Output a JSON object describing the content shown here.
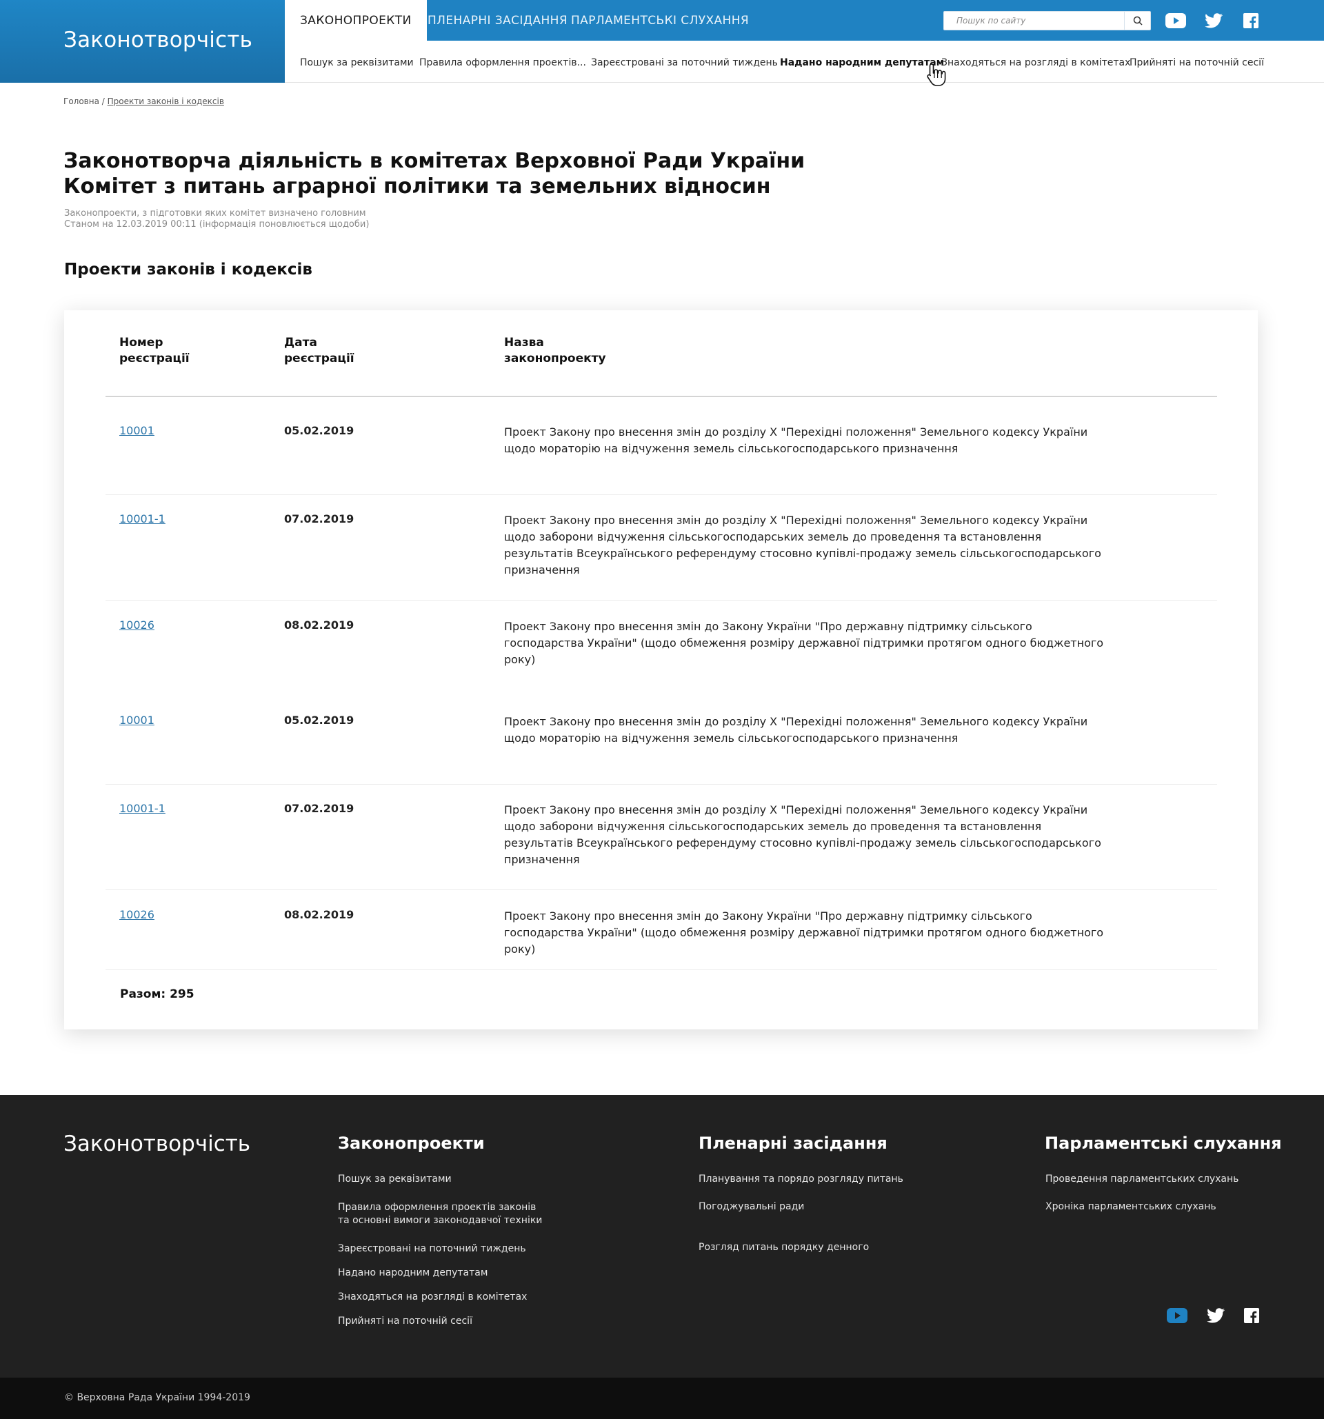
{
  "header": {
    "brand": "Законотворчість",
    "tabs": [
      {
        "label": "ЗАКОНОПРОЕКТИ",
        "active": true
      },
      {
        "label": "ПЛЕНАРНІ ЗАСІДАННЯ",
        "active": false
      },
      {
        "label": "ПАРЛАМЕНТСЬКІ СЛУХАННЯ",
        "active": false
      }
    ],
    "search": {
      "placeholder": "Пошук по сайту",
      "value": ""
    },
    "social": [
      "youtube-icon",
      "twitter-icon",
      "facebook-icon"
    ]
  },
  "subnav": {
    "items": [
      {
        "label": "Пошук за реквізитами"
      },
      {
        "label": "Правила оформлення проектів..."
      },
      {
        "label": "Зареєстровані за поточний тиждень"
      },
      {
        "label": "Надано народним депутатам"
      },
      {
        "label": "Знаходяться на розгляді в комітетах"
      },
      {
        "label": "Прийняті на поточній сесії"
      }
    ]
  },
  "breadcrumb": {
    "home": "Головна",
    "separator": " / ",
    "current": "Проекти законів і кодексів"
  },
  "page": {
    "title_line1": "Законотворча діяльність в комітетах Верховної Ради України",
    "title_line2": "Комітет з питань аграрної політики та земельних відносин",
    "meta_line1": "Законопроекти, з підготовки яких комітет визначено головним",
    "meta_line2": "Станом на 12.03.2019 00:11 (інформація поновлюється щодоби)",
    "section_title": "Проекти законів і кодексів"
  },
  "table": {
    "headers": {
      "number_line1": "Номер",
      "number_line2": "реєстрації",
      "date_line1": "Дата",
      "date_line2": "реєстрації",
      "name_line1": "Назва",
      "name_line2": "законопроекту"
    },
    "rows": [
      {
        "number": "10001",
        "date": "05.02.2019",
        "name": "Проект Закону про внесення змін до розділу X \"Перехідні положення\" Земельного кодексу України щодо мораторію на відчуження земель сільськогосподарського призначення"
      },
      {
        "number": "10001-1",
        "date": "07.02.2019",
        "name": "Проект Закону про внесення змін до розділу X \"Перехідні положення\" Земельного кодексу України щодо заборони відчуження сільськогосподарських земель до проведення та встановлення результатів Всеукраїнського референдуму стосовно купівлі-продажу земель сільськогосподарського призначення"
      },
      {
        "number": "10026",
        "date": "08.02.2019",
        "name": "Проект Закону про внесення змін до Закону України \"Про державну підтримку сільського господарства України\" (щодо обмеження розміру державної підтримки протягом одного бюджетного року)"
      },
      {
        "number": "10001",
        "date": "05.02.2019",
        "name": "Проект Закону про внесення змін до розділу X \"Перехідні положення\" Земельного кодексу України щодо мораторію на відчуження земель сільськогосподарського призначення"
      },
      {
        "number": "10001-1",
        "date": "07.02.2019",
        "name": "Проект Закону про внесення змін до розділу X \"Перехідні положення\" Земельного кодексу України щодо заборони відчуження сільськогосподарських земель до проведення та встановлення результатів Всеукраїнського референдуму стосовно купівлі-продажу земель сільськогосподарського призначення"
      },
      {
        "number": "10026",
        "date": "08.02.2019",
        "name": "Проект Закону про внесення змін до Закону України \"Про державну підтримку сільського господарства України\" (щодо обмеження розміру державної підтримки протягом одного бюджетного року)"
      }
    ],
    "total": "Разом: 295"
  },
  "footer": {
    "brand": "Законотворчість",
    "columns": [
      {
        "title": "Законопроекти",
        "links": [
          "Пошук за реквізитами",
          "Правила оформлення проектів законів\nта основні вимоги законодавчої техніки",
          "Зареєстровані на поточний тиждень",
          "Надано народним депутатам",
          "Знаходяться на розгляді в комітетах",
          "Прийняті на поточній сесії"
        ]
      },
      {
        "title": "Пленарні засідання",
        "links": [
          "Планування та порядо розгляду питань",
          "Погоджувальні ради",
          "Розгляд питань порядку денного"
        ]
      },
      {
        "title": "Парламентські слухання",
        "links": [
          "Проведення парламентських слухань",
          "Хроніка парламентських слухань"
        ]
      }
    ],
    "copyright": "© Верховна Рада України 1994-2019"
  },
  "colors": {
    "brand_blue": "#1f82c2",
    "link_blue": "#2a74a8",
    "footer_bg": "#212121",
    "copyright_bg": "#0e0e0e"
  }
}
